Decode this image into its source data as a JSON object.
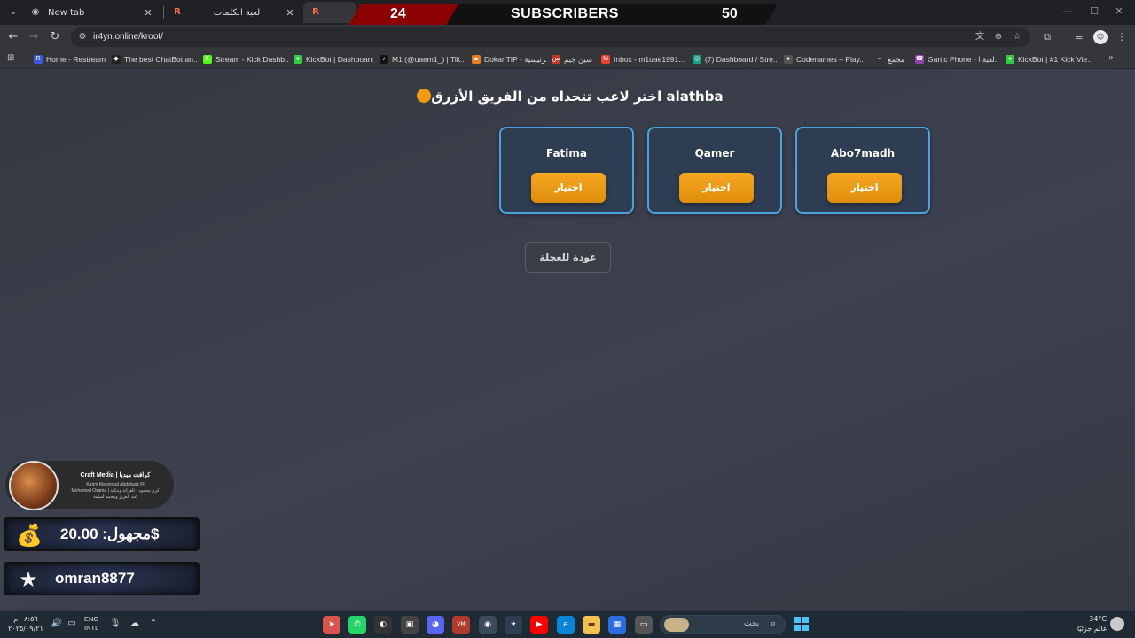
{
  "tabs": [
    {
      "title": "New tab",
      "icon": "chrome-icon"
    },
    {
      "title": "لعبة الكلمات",
      "icon": "r-logo-icon"
    },
    {
      "title": "",
      "icon": "r-logo-icon"
    }
  ],
  "subscriber_banner": {
    "current": "24",
    "label": "SUBSCRIBERS",
    "goal": "50"
  },
  "address_bar": {
    "url": "ir4yn.online/kroot/"
  },
  "bookmarks": [
    {
      "label": "Home - Restream",
      "color": "#3b5bdb",
      "glyph": "R"
    },
    {
      "label": "The best ChatBot an...",
      "color": "#222222",
      "glyph": "◆"
    },
    {
      "label": "Stream - Kick Dashb...",
      "color": "#53fc18",
      "glyph": "K"
    },
    {
      "label": "KickBot | Dashboard",
      "color": "#2ecc40",
      "glyph": "●"
    },
    {
      "label": "M1 (@uaem1_) | Tik...",
      "color": "#111111",
      "glyph": "♪"
    },
    {
      "label": "DokanTIP - الرئيسية",
      "color": "#e67e22",
      "glyph": "▲"
    },
    {
      "label": "سين جيم",
      "color": "#c0392b",
      "glyph": "س"
    },
    {
      "label": "Inbox - m1uae1991...",
      "color": "#ea4335",
      "glyph": "M"
    },
    {
      "label": "(7) Dashboard / Stre...",
      "color": "#16a085",
      "glyph": "◎"
    },
    {
      "label": "Codenames – Play...",
      "color": "#555555",
      "glyph": "●"
    },
    {
      "label": "مجمع",
      "color": "#35363a",
      "glyph": "–"
    },
    {
      "label": "Gartic Phone - لعبة ا...",
      "color": "#8e44ad",
      "glyph": "☎"
    },
    {
      "label": "KickBot | #1 Kick Vie...",
      "color": "#2ecc40",
      "glyph": "●"
    }
  ],
  "page": {
    "heading": "alathba اختر لاعب تتحداه من الفريق الأزرق",
    "players": [
      {
        "name": "Fatima",
        "button": "اختيار"
      },
      {
        "name": "Qamer",
        "button": "اختيار"
      },
      {
        "name": "Abo7madh",
        "button": "اختيار"
      }
    ],
    "back_button": "عودة للعجلة",
    "accent_color": "#f39c12",
    "card_border_color": "#4aa3df"
  },
  "overlays": {
    "craft_media": {
      "title": "Craft Media | كرافت ميديا",
      "lines": [
        "Karim Mahmoud Abdelaziz Ft",
        "Mohamed Osama | كرم محمود - القرآنة ونتكلة",
        "عبد العزيز ومحمد أسامة"
      ]
    },
    "donation": {
      "text": "مجهول: 20.00$",
      "icon": "money-bag-icon"
    },
    "follower": {
      "text": "omran8877",
      "icon": "star-icon"
    }
  },
  "taskbar": {
    "time": "٠٨:٥٦ م",
    "date": "٢٠٢٥/٠٩/٢١",
    "lang_top": "ENG",
    "lang_bottom": "INTL",
    "search_placeholder": "بحث",
    "temperature": "34°C",
    "weather_desc": "غائم جزئيًا"
  }
}
